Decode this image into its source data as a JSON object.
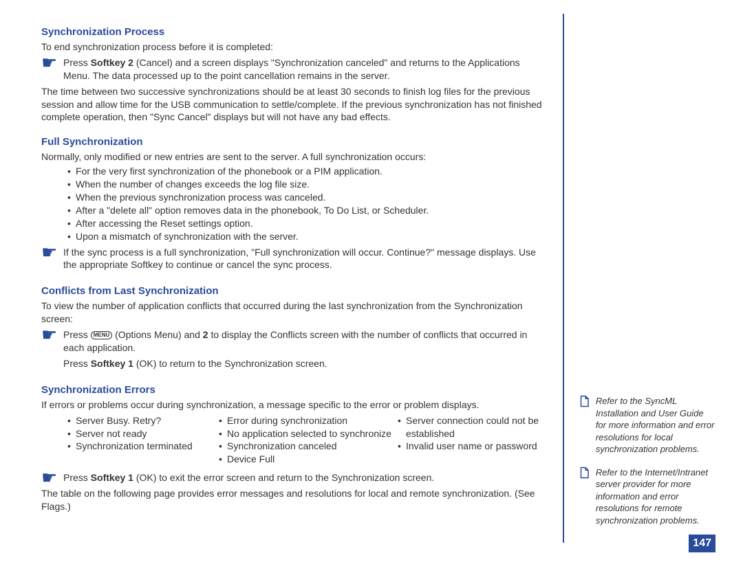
{
  "sections": {
    "sync_process": {
      "title": "Synchronization Process",
      "intro": "To end synchronization process before it is completed:",
      "pointer_pre": "Press ",
      "pointer_bold": "Softkey 2",
      "pointer_post": " (Cancel) and a screen displays \"Synchronization canceled\" and returns to the Applications Menu. The data processed up to the point cancellation remains in the server.",
      "para": "The time between two successive synchronizations should be at least 30 seconds to finish log files for the previous session and allow time for the USB communication to settle/complete. If the previous synchronization has not finished complete operation, then \"Sync Cancel\" displays but will not have any bad effects."
    },
    "full_sync": {
      "title": "Full Synchronization",
      "intro": "Normally, only modified or new entries are sent to the server. A full synchronization occurs:",
      "bullets": [
        "For the very first synchronization of the phonebook or a PIM application.",
        "When the number of changes exceeds the log file size.",
        "When the previous synchronization process was canceled.",
        "After a \"delete all\" option removes data in the phonebook, To Do List, or Scheduler.",
        "After accessing the Reset settings option.",
        "Upon a mismatch of synchronization with the server."
      ],
      "pointer": "If the sync process is a full synchronization, \"Full synchronization will occur. Continue?\" message displays. Use the appropriate Softkey to continue or cancel the sync process."
    },
    "conflicts": {
      "title": "Conflicts from Last Synchronization",
      "intro": "To view the number of application conflicts that occurred during the last synchronization from the Synchronization screen:",
      "p1_pre": "Press ",
      "p1_menu": "MENU",
      "p1_mid1": " (Options Menu) and ",
      "p1_bold1": "2",
      "p1_post1": " to display the Conflicts screen with the number of conflicts that occurred in each application.",
      "p2_pre": "Press ",
      "p2_bold": "Softkey 1",
      "p2_post": " (OK) to return to the Synchronization screen."
    },
    "errors": {
      "title": "Synchronization Errors",
      "intro": "If errors or problems occur during synchronization, a message specific to the error or problem displays.",
      "col1": [
        "Server Busy. Retry?",
        "Server not ready",
        "Synchronization terminated"
      ],
      "col2": [
        "Error during synchronization",
        "No application selected to synchronize",
        "Synchronization canceled",
        "Device Full"
      ],
      "col3": [
        "Server connection could not be",
        "established",
        "Invalid user name or password"
      ],
      "p_pre": "Press ",
      "p_bold": "Softkey 1",
      "p_post": " (OK) to exit the error screen and return to the Synchronization screen.",
      "para": "The table on the following page provides error messages and resolutions for local and remote synchronization. (See Flags.)"
    }
  },
  "sidebar": {
    "note1": "Refer to the SyncML Installation and User Guide for more information and error resolutions for local synchronization problems.",
    "note2": "Refer to the Internet/Intranet server provider for more information and error resolutions for remote synchronization problems."
  },
  "page_number": "147"
}
